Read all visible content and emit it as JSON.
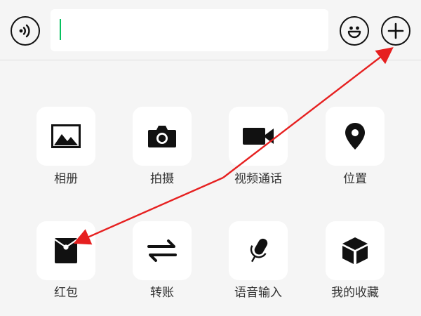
{
  "accent_color": "#07c160",
  "annotation_color": "#e62020",
  "toolbar": {
    "voice_icon": "voice-icon",
    "emoji_icon": "emoji-icon",
    "more_icon": "plus-icon",
    "input_value": ""
  },
  "panel": {
    "items": [
      {
        "label": "相册",
        "icon": "image-icon"
      },
      {
        "label": "拍摄",
        "icon": "camera-icon"
      },
      {
        "label": "视频通话",
        "icon": "video-icon"
      },
      {
        "label": "位置",
        "icon": "location-icon"
      },
      {
        "label": "红包",
        "icon": "red-packet-icon"
      },
      {
        "label": "转账",
        "icon": "transfer-icon"
      },
      {
        "label": "语音输入",
        "icon": "microphone-icon"
      },
      {
        "label": "我的收藏",
        "icon": "favorites-box-icon"
      }
    ]
  }
}
